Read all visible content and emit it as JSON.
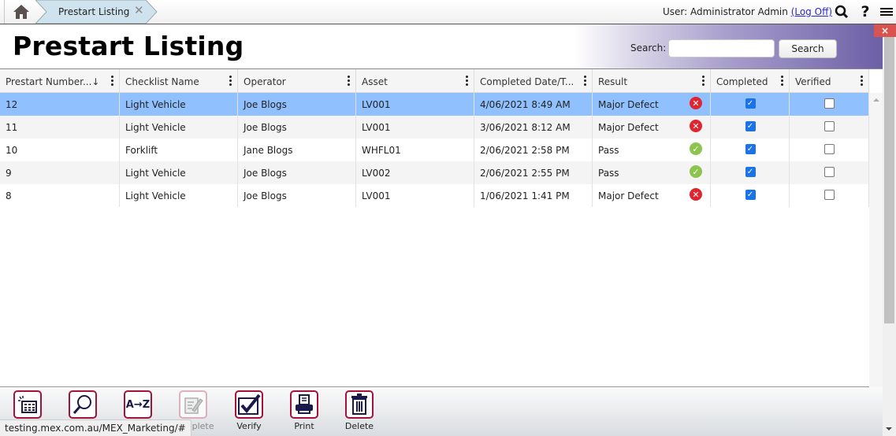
{
  "topbar": {
    "home_icon": "home-icon",
    "tab_label": "Prestart Listing",
    "tab_close": "✕",
    "user_prefix": "User: Administrator Admin ",
    "logoff": "(Log Off)",
    "search_icon": "search-icon",
    "help_icon": "?",
    "menu_icon": "≡"
  },
  "header": {
    "title": "Prestart Listing",
    "search_label": "Search:",
    "search_value": "",
    "search_placeholder": "",
    "search_button": "Search",
    "close_label": "×"
  },
  "grid": {
    "columns": [
      {
        "label": "Prestart Number...↓"
      },
      {
        "label": "Checklist Name"
      },
      {
        "label": "Operator"
      },
      {
        "label": "Asset"
      },
      {
        "label": "Completed Date/T..."
      },
      {
        "label": "Result"
      },
      {
        "label": "Completed"
      },
      {
        "label": "Verified"
      }
    ],
    "rows": [
      {
        "number": "12",
        "checklist": "Light Vehicle",
        "operator": "Joe Blogs",
        "asset": "LV001",
        "date": "4/06/2021 8:49 AM",
        "result": "Major Defect",
        "result_status": "fail",
        "completed": true,
        "verified": false,
        "selected": true
      },
      {
        "number": "11",
        "checklist": "Light Vehicle",
        "operator": "Joe Blogs",
        "asset": "LV001",
        "date": "3/06/2021 8:12 AM",
        "result": "Major Defect",
        "result_status": "fail",
        "completed": true,
        "verified": false,
        "selected": false
      },
      {
        "number": "10",
        "checklist": "Forklift",
        "operator": "Jane Blogs",
        "asset": "WHFL01",
        "date": "2/06/2021 2:58 PM",
        "result": "Pass",
        "result_status": "pass",
        "completed": true,
        "verified": false,
        "selected": false
      },
      {
        "number": "9",
        "checklist": "Light Vehicle",
        "operator": "Joe Blogs",
        "asset": "LV002",
        "date": "2/06/2021 2:55 PM",
        "result": "Pass",
        "result_status": "pass",
        "completed": true,
        "verified": false,
        "selected": false
      },
      {
        "number": "8",
        "checklist": "Light Vehicle",
        "operator": "Joe Blogs",
        "asset": "LV001",
        "date": "1/06/2021 1:41 PM",
        "result": "Major Defect",
        "result_status": "fail",
        "completed": true,
        "verified": false,
        "selected": false
      }
    ]
  },
  "toolbar": {
    "tools": [
      {
        "name": "new",
        "label": "",
        "icon": "new-record-icon",
        "disabled": false
      },
      {
        "name": "find",
        "label": "",
        "icon": "magnifier-icon",
        "disabled": false
      },
      {
        "name": "sort",
        "label": "",
        "icon": "a-to-z-icon",
        "icon_text": "A→Z",
        "disabled": false
      },
      {
        "name": "complete",
        "label": "Complete",
        "icon": "edit-document-icon",
        "disabled": true
      },
      {
        "name": "verify",
        "label": "Verify",
        "icon": "checkmark-box-icon",
        "disabled": false
      },
      {
        "name": "print",
        "label": "Print",
        "icon": "printer-icon",
        "disabled": false
      },
      {
        "name": "delete",
        "label": "Delete",
        "icon": "trash-icon",
        "disabled": false
      }
    ]
  },
  "statusbar": {
    "url": "testing.mex.com.au/MEX_Marketing/#"
  },
  "colors": {
    "selected_row": "#90c0fd",
    "accent_border": "#a3123a",
    "fail": "#e0252f",
    "pass": "#8cc44e",
    "checkbox": "#1a73e8",
    "close_red": "#d9534f"
  }
}
